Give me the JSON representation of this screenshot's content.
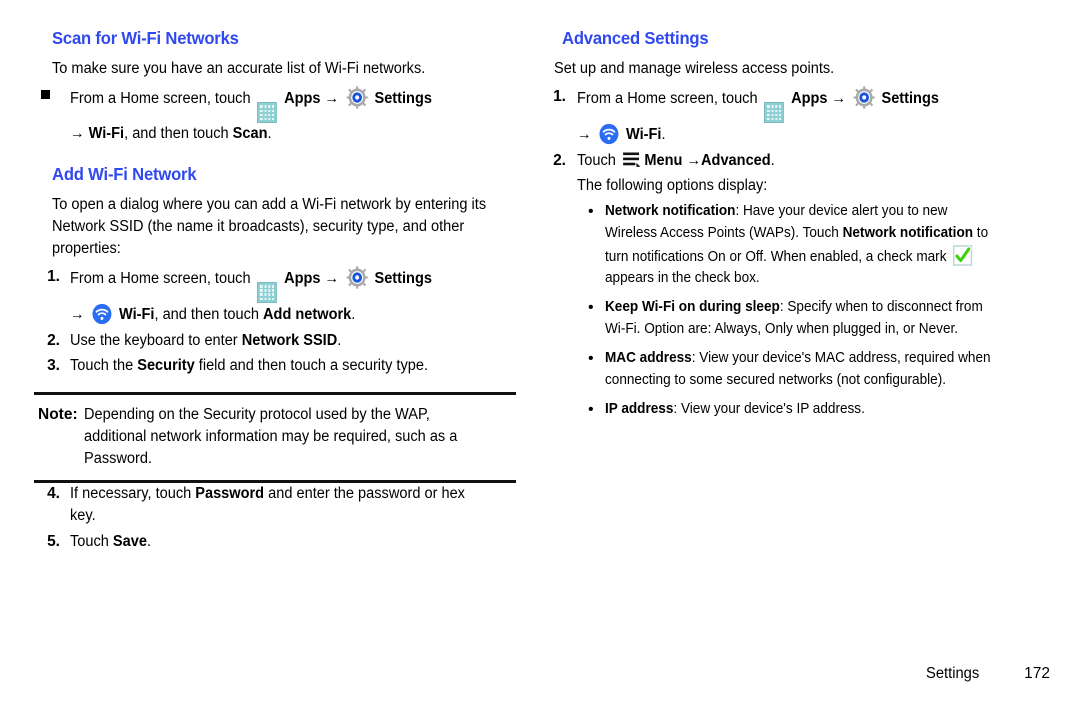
{
  "page": {
    "footer_label": "Settings",
    "footer_page": "172",
    "heading_color": "#3049ee"
  },
  "left_column": {
    "section1": {
      "heading": "Scan for Wi-Fi Networks",
      "intro": "To make sure you have an accurate list of Wi-Fi networks.",
      "bullet": {
        "marker": "square-bullet",
        "line1_pre": "From a Home screen, touch",
        "apps_label": "Apps",
        "arrow": "→",
        "settings_label": "Settings",
        "line2_pre": "Wi-Fi",
        "line2_mid": ", and then touch ",
        "line2_bold": "Scan",
        "line2_end": "."
      }
    },
    "section2": {
      "heading": "Add Wi-Fi Network",
      "intro": "To open a dialog where you can add a Wi-Fi network by entering its Network SSID (the name it broadcasts), security type, and other properties:",
      "steps": [
        {
          "marker": "1.",
          "line1_pre": "From a Home screen, touch",
          "apps_label": "Apps",
          "arrow": "→",
          "settings_label": "Settings",
          "line2_label": "Wi-Fi",
          "line2_mid": ", and then touch ",
          "line2_bold": "Add network",
          "line2_end": "."
        },
        {
          "marker": "2.",
          "text_pre": "Use the keyboard to enter ",
          "text_bold": "Network SSID",
          "text_end": "."
        },
        {
          "marker": "3.",
          "text_pre": "Touch the ",
          "text_bold": "Security",
          "text_end": " field and then touch a security type."
        }
      ]
    },
    "note": {
      "label": "Note:",
      "text": "Depending on the Security protocol used by the WAP, additional network information may be required, such as a Password."
    },
    "steps_after_note": [
      {
        "marker": "4.",
        "text_pre": "If necessary, touch ",
        "text_bold": "Password",
        "text_end": " and enter the password or hex key."
      },
      {
        "marker": "5.",
        "text_pre": "Touch ",
        "text_bold": "Save",
        "text_end": "."
      }
    ]
  },
  "right_column": {
    "heading": "Advanced Settings",
    "intro": "Set up and manage wireless access points.",
    "steps": [
      {
        "marker": "1.",
        "line1_pre": "From a Home screen, touch",
        "apps_label": "Apps",
        "arrow": "→",
        "settings_label": "Settings",
        "line2_label": "Wi-Fi",
        "line2_end": "."
      },
      {
        "marker": "2.",
        "text_pre": "Touch ",
        "menu_label": "Menu",
        "arrow": "→",
        "text_bold": "Advanced",
        "text_end": "."
      }
    ],
    "sub_line": "The following options display:",
    "options": [
      {
        "bullet": "•",
        "title": "Network notification",
        "text_a": ": Have your device alert you to new Wireless Access Points (WAPs). Touch ",
        "title_b": "Network notification",
        "text_b": " to turn notifications On or Off. When enabled, a check mark ",
        "text_c": " appears in the check box.",
        "has_check_icon": true
      },
      {
        "bullet": "•",
        "title": "Keep Wi-Fi on during sleep",
        "text_a": ": Specify when to disconnect from Wi-Fi. Option are: Always, Only when plugged in, or Never.",
        "has_check_icon": false
      },
      {
        "bullet": "•",
        "title": "MAC address",
        "text_a": ": View your device's MAC address, required when connecting to some secured networks (not configurable).",
        "has_check_icon": false
      },
      {
        "bullet": "•",
        "title": "IP address",
        "text_a": ": View your device's IP address.",
        "has_check_icon": false
      }
    ]
  },
  "icons": {
    "apps": "apps-grid-icon",
    "settings": "settings-gear-icon",
    "wifi": "wifi-icon",
    "menu": "menu-hamburger-icon",
    "check": "green-check-icon"
  }
}
